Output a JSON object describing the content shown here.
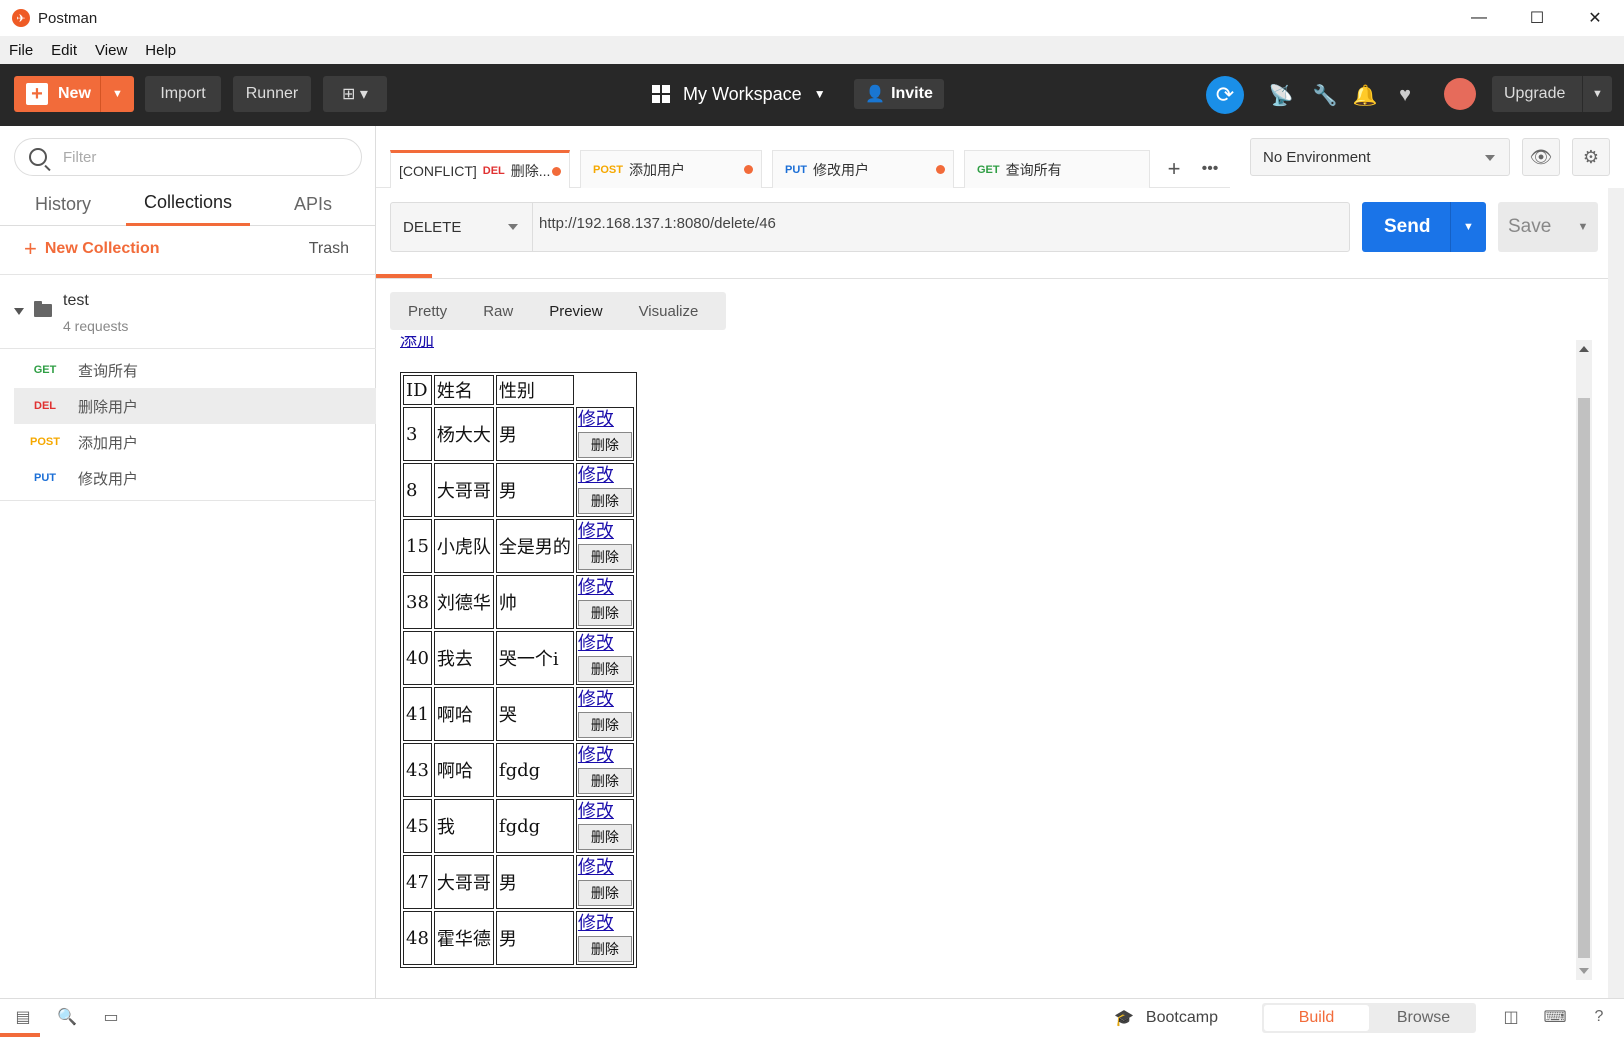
{
  "window": {
    "title": "Postman"
  },
  "menu": [
    "File",
    "Edit",
    "View",
    "Help"
  ],
  "header": {
    "new_label": "New",
    "import_label": "Import",
    "runner_label": "Runner",
    "workspace_label": "My Workspace",
    "invite_label": "Invite",
    "upgrade_label": "Upgrade"
  },
  "sidebar": {
    "filter_placeholder": "Filter",
    "tabs": [
      "History",
      "Collections",
      "APIs"
    ],
    "active_tab": "Collections",
    "new_collection_label": "New Collection",
    "trash_label": "Trash",
    "collection": {
      "name": "test",
      "count": "4 requests"
    },
    "requests": [
      {
        "method": "GET",
        "name": "查询所有",
        "color": "#2f9e44"
      },
      {
        "method": "DEL",
        "name": "删除用户",
        "color": "#e03131"
      },
      {
        "method": "POST",
        "name": "添加用户",
        "color": "#f5a800"
      },
      {
        "method": "PUT",
        "name": "修改用户",
        "color": "#1c6fd6"
      }
    ]
  },
  "tabs": [
    {
      "prefix": "[CONFLICT]",
      "method": "DEL",
      "name": "删除...",
      "color": "#e03131"
    },
    {
      "prefix": "",
      "method": "POST",
      "name": "添加用户",
      "color": "#f5a800"
    },
    {
      "prefix": "",
      "method": "PUT",
      "name": "修改用户",
      "color": "#1c6fd6"
    },
    {
      "prefix": "",
      "method": "GET",
      "name": "查询所有",
      "color": "#2f9e44"
    }
  ],
  "environment": {
    "selected": "No Environment"
  },
  "request": {
    "method": "DELETE",
    "url": "http://192.168.137.1:8080/delete/46",
    "send_label": "Send",
    "save_label": "Save"
  },
  "response": {
    "view_tabs": [
      "Pretty",
      "Raw",
      "Preview",
      "Visualize"
    ],
    "active_view": "Preview",
    "top_link": "添加",
    "table": {
      "headers": [
        "ID",
        "姓名",
        "性别"
      ],
      "edit_label": "修改",
      "delete_label": "删除",
      "rows": [
        [
          "3",
          "杨大大",
          "男"
        ],
        [
          "8",
          "大哥哥",
          "男"
        ],
        [
          "15",
          "小虎队",
          "全是男的"
        ],
        [
          "38",
          "刘德华",
          "帅"
        ],
        [
          "40",
          "我去",
          "哭一个i"
        ],
        [
          "41",
          "啊哈",
          "哭"
        ],
        [
          "43",
          "啊哈",
          "fgdg"
        ],
        [
          "45",
          "我",
          "fgdg"
        ],
        [
          "47",
          "大哥哥",
          "男"
        ],
        [
          "48",
          "霍华德",
          "男"
        ]
      ]
    }
  },
  "statusbar": {
    "bootcamp_label": "Bootcamp",
    "build_label": "Build",
    "browse_label": "Browse"
  }
}
